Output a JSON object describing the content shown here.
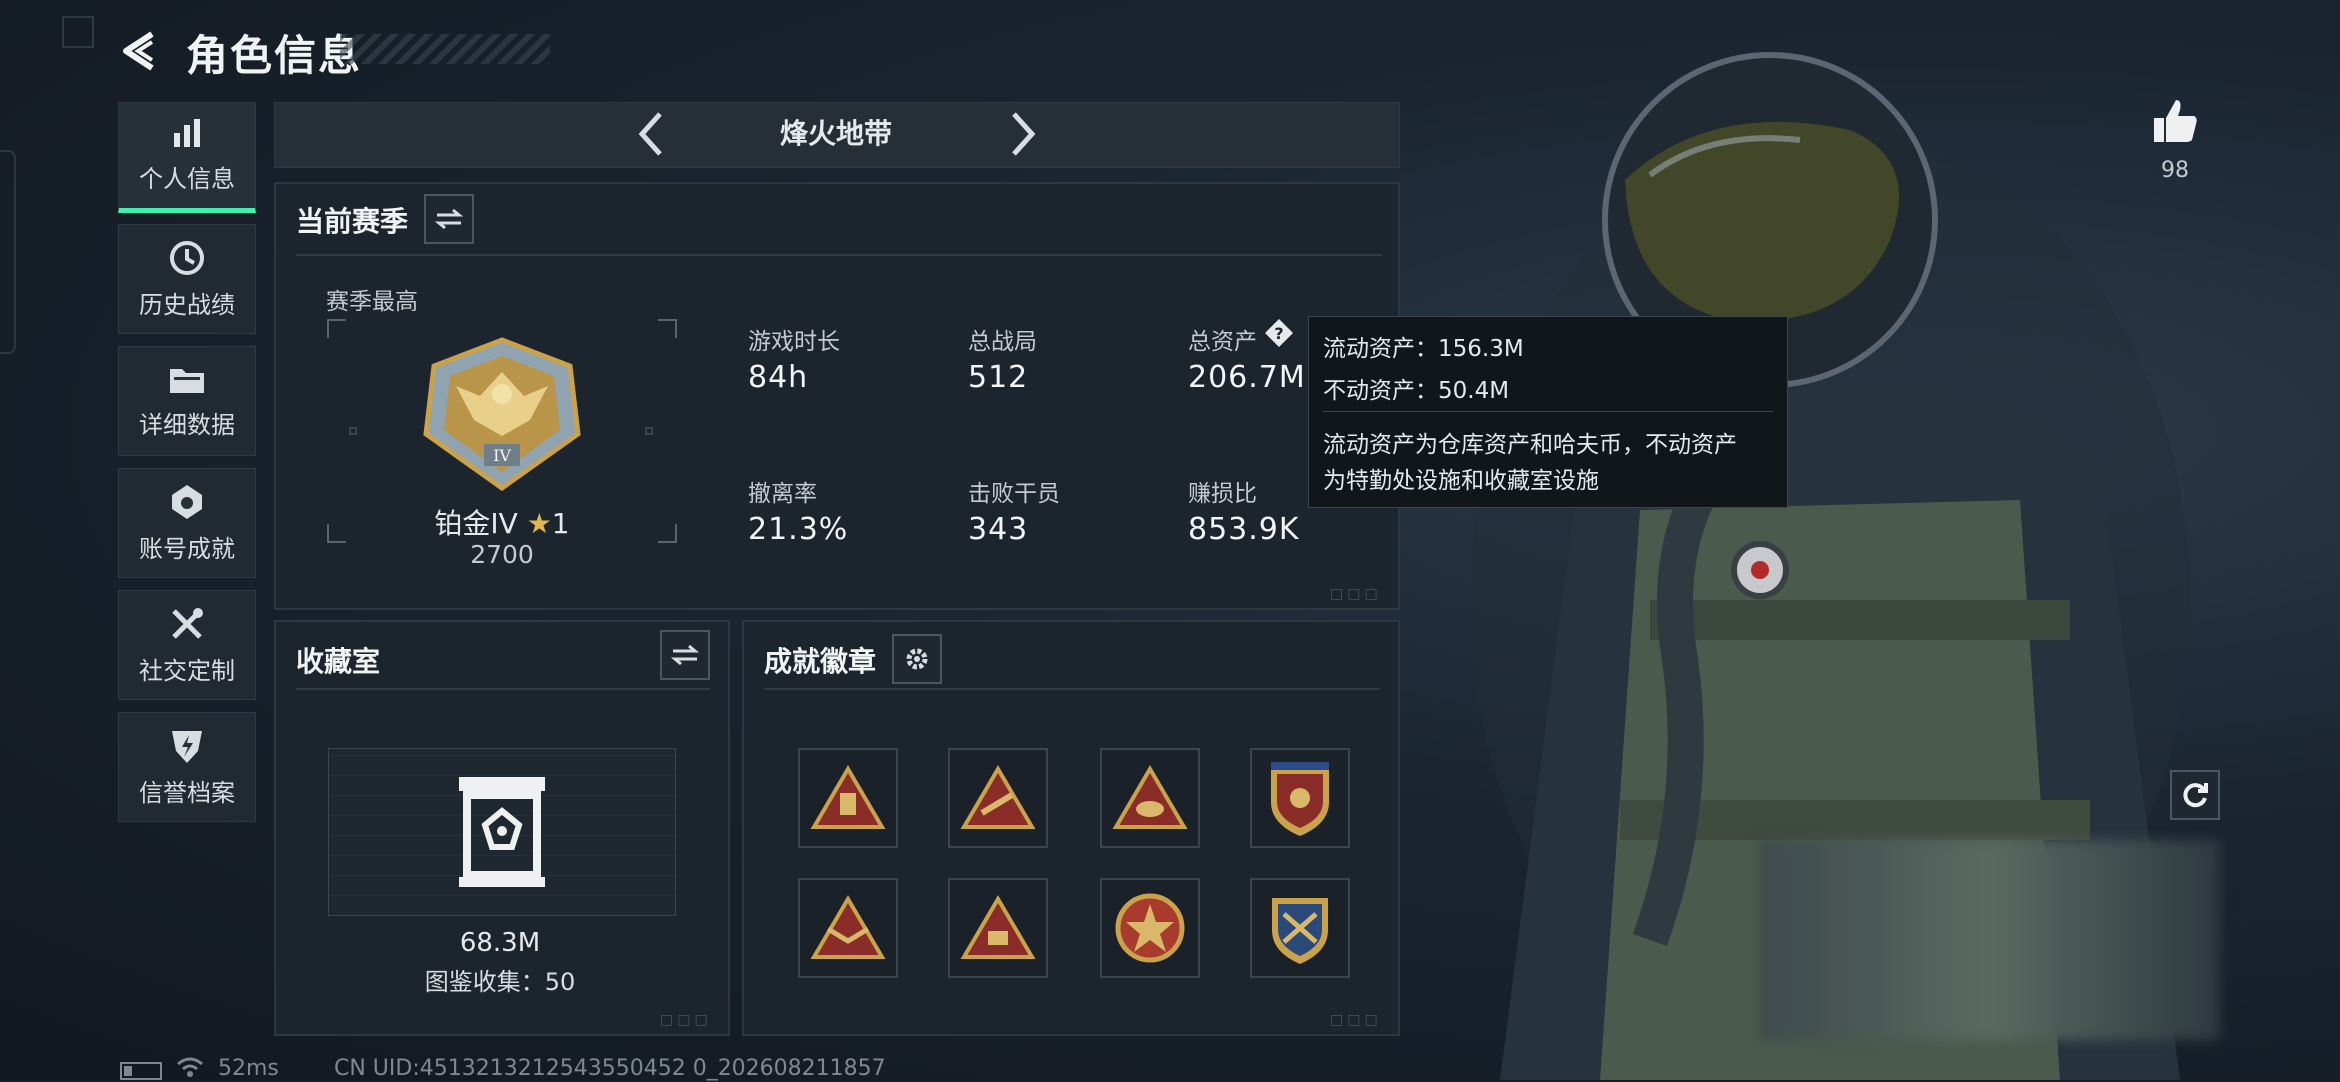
{
  "header": {
    "title": "角色信息"
  },
  "sidebar": {
    "items": [
      {
        "label": "个人信息",
        "icon": "bar-chart-icon",
        "active": true
      },
      {
        "label": "历史战绩",
        "icon": "clock-history-icon"
      },
      {
        "label": "详细数据",
        "icon": "folder-icon"
      },
      {
        "label": "账号成就",
        "icon": "medal-icon"
      },
      {
        "label": "社交定制",
        "icon": "tools-icon"
      },
      {
        "label": "信誉档案",
        "icon": "shield-bolt-icon"
      }
    ]
  },
  "mode_selector": {
    "current": "烽火地带"
  },
  "season": {
    "title": "当前赛季",
    "highest_label": "赛季最高",
    "rank_name": "铂金IV",
    "rank_stars": "1",
    "rank_points": "2700",
    "stats": [
      {
        "label": "游戏时长",
        "value": "84h"
      },
      {
        "label": "总战局",
        "value": "512"
      },
      {
        "label": "总资产",
        "value": "206.7M"
      },
      {
        "label": "撤离率",
        "value": "21.3%"
      },
      {
        "label": "击败干员",
        "value": "343"
      },
      {
        "label": "赚损比",
        "value": "853.9K"
      }
    ]
  },
  "tooltip": {
    "liquid": "流动资产：156.3M",
    "fixed": "不动资产：50.4M",
    "desc1": "流动资产为仓库资产和哈夫币，不动资产",
    "desc2": "为特勤处设施和收藏室设施"
  },
  "collection": {
    "title": "收藏室",
    "value": "68.3M",
    "catalog": "图鉴收集：50"
  },
  "badges": {
    "title": "成就徽章"
  },
  "likes": {
    "count": "98"
  },
  "status_bar": {
    "ping": "52ms",
    "uid": "CN UID:4513213212543550452 0_202608211857"
  },
  "colors": {
    "accent": "#3ef0b4",
    "gold": "#c9a24a",
    "badge_red": "#8a2d28"
  }
}
